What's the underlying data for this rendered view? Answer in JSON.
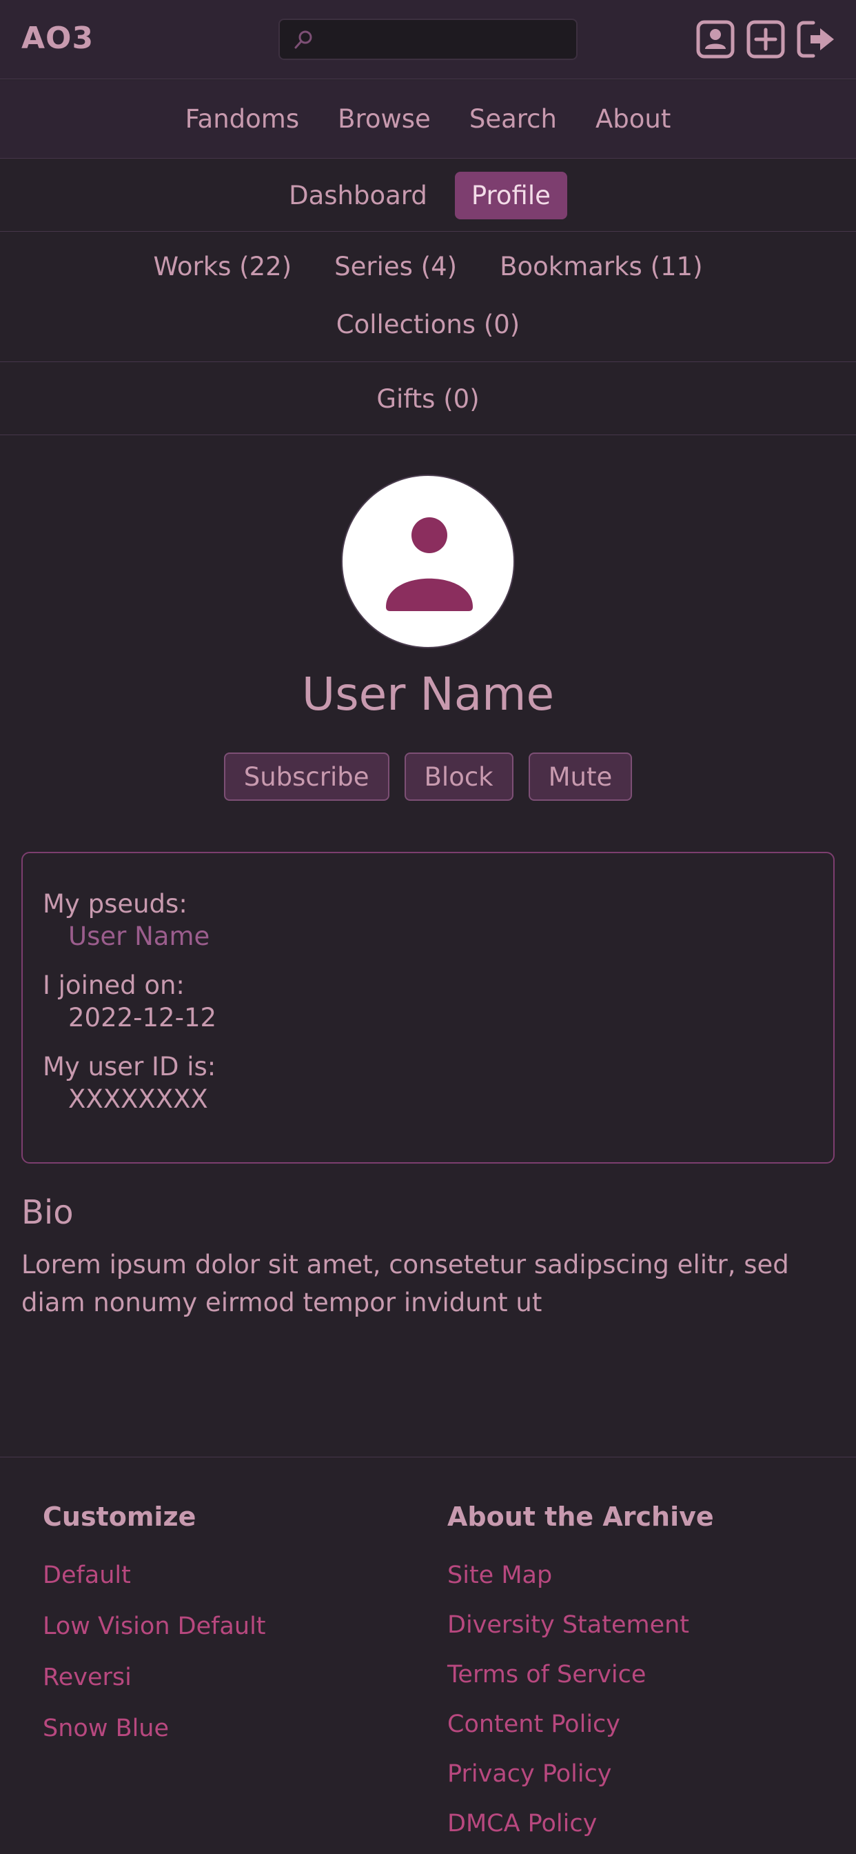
{
  "header": {
    "logo": "AO3",
    "search_placeholder": "",
    "icons": [
      "profile-icon",
      "add-icon",
      "logout-icon"
    ]
  },
  "nav": {
    "primary": [
      "Fandoms",
      "Browse",
      "Search",
      "About"
    ],
    "secondary": [
      "Dashboard",
      "Profile"
    ],
    "secondary_active": "Profile",
    "user_links": [
      "Works (22)",
      "Series (4)",
      "Bookmarks (11)",
      "Collections (0)"
    ],
    "gifts": "Gifts (0)"
  },
  "profile": {
    "username": "User Name",
    "actions": [
      "Subscribe",
      "Block",
      "Mute"
    ],
    "pseuds_label": "My pseuds:",
    "pseud": "User Name",
    "joined_label": "I joined on:",
    "joined": "2022-12-12",
    "userid_label": "My user ID is:",
    "userid": "XXXXXXXX"
  },
  "bio": {
    "title": "Bio",
    "text": "Lorem ipsum dolor sit amet, consetetur sadipscing elitr, sed diam nonumy eirmod tempor invidunt ut"
  },
  "footer": {
    "customize_title": "Customize",
    "customize_links": [
      "Default",
      "Low Vision Default",
      "Reversi",
      "Snow Blue"
    ],
    "about_title": "About the Archive",
    "about_links": [
      "Site Map",
      "Diversity Statement",
      "Terms of Service",
      "Content Policy",
      "Privacy Policy",
      "DMCA Policy"
    ]
  },
  "colors": {
    "background": "#272129",
    "header": "#2f2433",
    "text": "#c89aaf",
    "accent": "#7d3e6f",
    "link": "#b8487f"
  }
}
